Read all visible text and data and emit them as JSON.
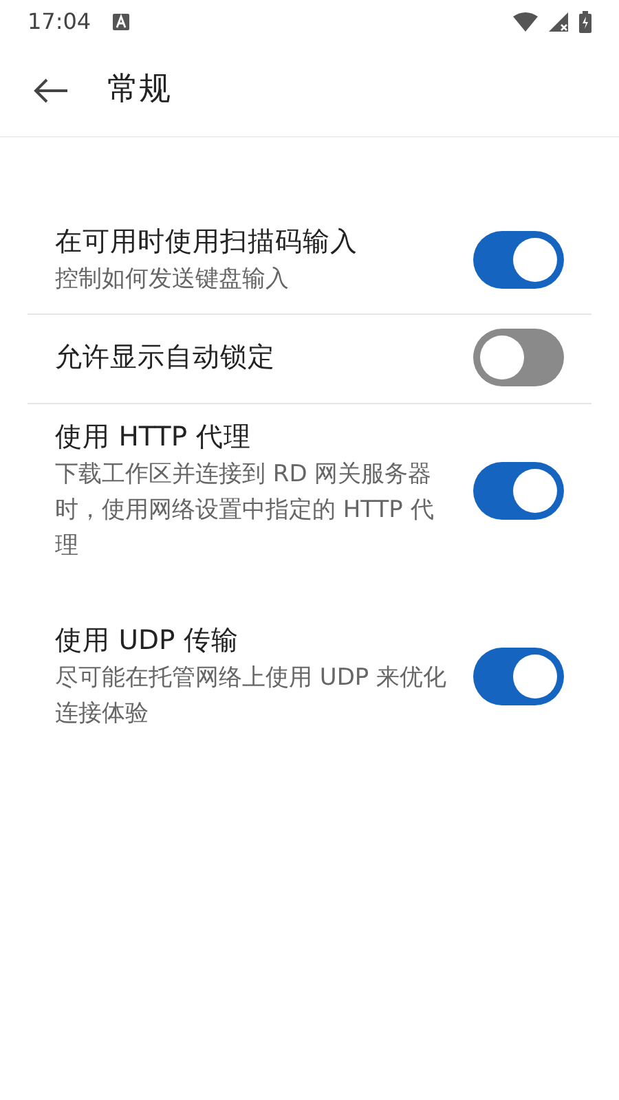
{
  "status_bar": {
    "time": "17:04"
  },
  "header": {
    "title": "常规"
  },
  "settings": [
    {
      "title": "在可用时使用扫描码输入",
      "description": "控制如何发送键盘输入",
      "on": true,
      "divider": true
    },
    {
      "title": "允许显示自动锁定",
      "on": false,
      "divider": true
    },
    {
      "title": "使用 HTTP 代理",
      "description": "下载工作区并连接到 RD 网关服务器时，使用网络设置中指定的 HTTP 代理",
      "on": true,
      "divider": false
    },
    {
      "title": "使用 UDP 传输",
      "description": "尽可能在托管网络上使用 UDP 来优化连接体验",
      "on": true,
      "divider": false
    }
  ]
}
